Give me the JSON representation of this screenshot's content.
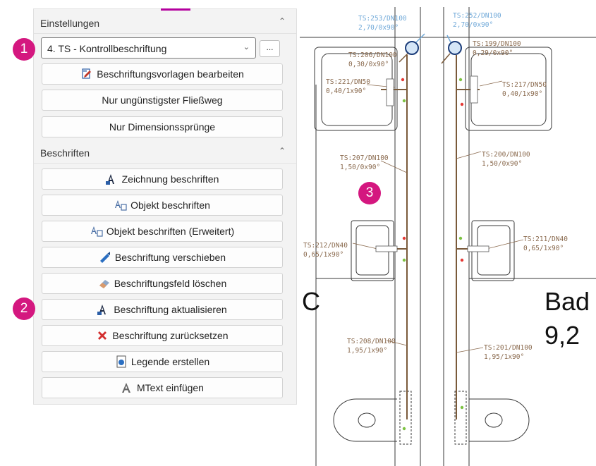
{
  "panel": {
    "settings_title": "Einstellungen",
    "template_select_value": "4. TS - Kontrollbeschriftung",
    "more_button": "...",
    "settings_buttons": [
      "Beschriftungsvorlagen bearbeiten",
      "Nur ungünstigster Fließweg",
      "Nur Dimensionssprünge"
    ],
    "label_title": "Beschriften",
    "label_buttons": [
      "Zeichnung beschriften",
      "Objekt beschriften",
      "Objekt beschriften (Erweitert)",
      "Beschriftung verschieben",
      "Beschriftungsfeld löschen",
      "Beschriftung aktualisieren",
      "Beschriftung zurücksetzen",
      "Legende erstellen",
      "MText einfügen"
    ]
  },
  "badges": [
    "1",
    "2",
    "3"
  ],
  "drawing": {
    "labels": {
      "ts253": [
        "TS:253/DN100",
        "2,70/0x90°"
      ],
      "ts252": [
        "TS:252/DN100",
        "2,70/0x90°"
      ],
      "ts206": [
        "TS:206/DN100",
        "0,30/0x90°"
      ],
      "ts199": [
        "TS:199/DN100",
        "0,29/0x90°"
      ],
      "ts221": [
        "TS:221/DN50",
        "0,40/1x90°"
      ],
      "ts217": [
        "TS:217/DN50",
        "0,40/1x90°"
      ],
      "ts207": [
        "TS:207/DN100",
        "1,50/0x90°"
      ],
      "ts200": [
        "TS:200/DN100",
        "1,50/0x90°"
      ],
      "ts212": [
        "TS:212/DN40",
        "0,65/1x90°"
      ],
      "ts211": [
        "TS:211/DN40",
        "0,65/1x90°"
      ],
      "ts208": [
        "TS:208/DN100",
        "1,95/1x90°"
      ],
      "ts201": [
        "TS:201/DN100",
        "1,95/1x90°"
      ]
    },
    "room_letter": "C",
    "room_name": "Bad",
    "room_area": "9,2"
  },
  "colors": {
    "badge": "#d4177f",
    "pipe": "#7a5a3a",
    "label_brown": "#8a6a4e",
    "label_blue": "#6fa8d8"
  }
}
